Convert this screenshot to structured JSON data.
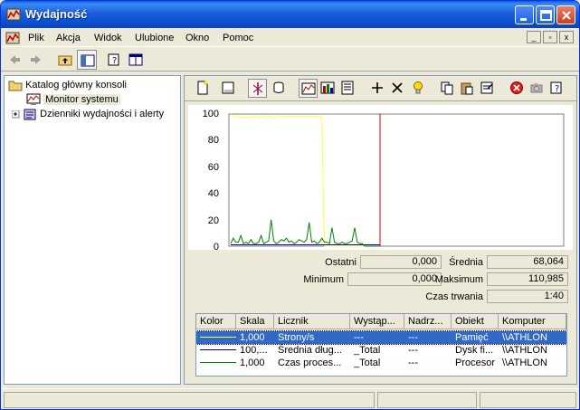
{
  "window": {
    "title": "Wydajność"
  },
  "menu": {
    "items": [
      "Plik",
      "Akcja",
      "Widok",
      "Ulubione",
      "Okno",
      "Pomoc"
    ]
  },
  "tree": {
    "root": "Katalog główny konsoli",
    "items": [
      "Monitor systemu",
      "Dzienniki wydajności i alerty"
    ]
  },
  "graph": {
    "y_ticks": [
      "100",
      "80",
      "60",
      "40",
      "20",
      "0"
    ]
  },
  "stats": {
    "last_label": "Ostatni",
    "last_value": "0,000",
    "avg_label": "Średnia",
    "avg_value": "68,064",
    "min_label": "Minimum",
    "min_value": "0,000",
    "max_label": "Maksimum",
    "max_value": "110,985",
    "duration_label": "Czas trwania",
    "duration_value": "1:40"
  },
  "legend": {
    "headers": [
      "Kolor",
      "Skala",
      "Licznik",
      "Wystąp...",
      "Nadrz...",
      "Obiekt",
      "Komputer"
    ],
    "rows": [
      {
        "color": "#ffff40",
        "scale": "1,000",
        "counter": "Strony/s",
        "instance": "---",
        "parent": "---",
        "object": "Pamięć",
        "computer": "\\\\ATHLON"
      },
      {
        "color": "#000080",
        "scale": "100,...",
        "counter": "Średnia dług...",
        "instance": "_Total",
        "parent": "---",
        "object": "Dysk fi...",
        "computer": "\\\\ATHLON"
      },
      {
        "color": "#008000",
        "scale": "1,000",
        "counter": "Czas proces...",
        "instance": "_Total",
        "parent": "---",
        "object": "Procesor",
        "computer": "\\\\ATHLON"
      }
    ]
  },
  "chart_data": {
    "type": "line",
    "ylim": [
      0,
      100
    ],
    "series": [
      {
        "name": "Strony/s",
        "color": "#ffff40",
        "values": [
          100,
          98,
          98,
          98,
          97,
          98,
          97,
          98,
          97,
          98,
          98,
          97,
          98,
          98,
          97,
          98,
          98,
          97,
          98,
          98,
          98,
          98,
          98,
          98,
          98,
          98,
          98,
          98,
          98,
          98,
          98,
          98,
          98,
          98,
          98,
          98,
          98,
          0,
          0,
          0,
          0,
          0,
          0,
          0,
          0,
          0,
          0,
          0,
          0,
          0,
          0,
          0,
          0,
          0,
          0,
          0,
          0,
          0,
          0,
          0
        ]
      },
      {
        "name": "Średnia dług...",
        "color": "#000080",
        "values": [
          1,
          1,
          1,
          1,
          1,
          1,
          1,
          1,
          1,
          1,
          1,
          1,
          1,
          1,
          1,
          1,
          1,
          1,
          1,
          1,
          1,
          1,
          1,
          1,
          1,
          1,
          1,
          1,
          1,
          1,
          1,
          1,
          1,
          1,
          1,
          1,
          1,
          1,
          1,
          1,
          1,
          1,
          1,
          1,
          1,
          1,
          1,
          1,
          1,
          1,
          1,
          1,
          1,
          1,
          1,
          1,
          1,
          1,
          1,
          1
        ]
      },
      {
        "name": "Czas proces...",
        "color": "#008000",
        "values": [
          2,
          6,
          3,
          3,
          8,
          2,
          3,
          2,
          5,
          2,
          2,
          3,
          8,
          2,
          3,
          4,
          20,
          4,
          2,
          3,
          5,
          4,
          6,
          3,
          4,
          2,
          3,
          5,
          4,
          3,
          5,
          18,
          3,
          4,
          2,
          3,
          6,
          3,
          3,
          2,
          14,
          3,
          2,
          2,
          3,
          2,
          2,
          3,
          4,
          14,
          3,
          2,
          2,
          0,
          0,
          0,
          0,
          0,
          0,
          0
        ]
      }
    ]
  }
}
